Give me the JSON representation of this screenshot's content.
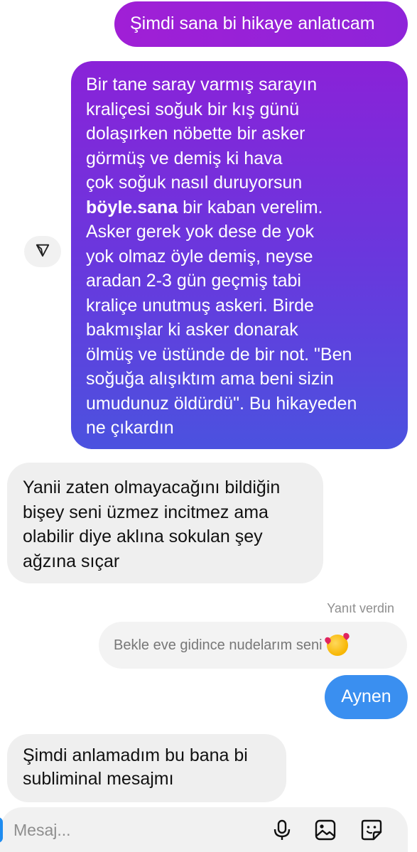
{
  "messages": {
    "m1": "Şimdi sana bi hikaye anlatıcam",
    "m2": {
      "l1": "Bir tane saray varmış sarayın",
      "l2": "kraliçesi soğuk bir kış günü",
      "l3": "dolaşırken nöbette bir asker",
      "l4": "görmüş ve demiş ki hava",
      "l5": "çok soğuk nasıl duruyorsun",
      "l6_bold": "böyle.sana",
      "l6_rest": " bir kaban verelim.",
      "l7": "Asker gerek yok dese de yok",
      "l8": "yok olmaz öyle demiş, neyse",
      "l9": "aradan 2-3 gün geçmiş tabi",
      "l10": "kraliçe unutmuş askeri. Birde",
      "l11": "bakmışlar ki asker donarak",
      "l12": "ölmüş ve üstünde de bir not. \"Ben",
      "l13": "soğuğa alışıktım ama beni sizin",
      "l14": "umudunuz öldürdü\". Bu hikayeden",
      "l15": "ne çıkardın"
    },
    "m4": {
      "l1": "Yanii zaten olmayacağını bildiğin",
      "l2": "bişey seni üzmez incitmez ama",
      "l3": "olabilir diye aklına sokulan şey",
      "l4": "ağzına sıçar"
    },
    "reply_meta": "Yanıt verdin",
    "reply_quote": "Bekle eve gidince nudelarım seni",
    "m5": "Aynen",
    "m6": {
      "l1": "Şimdi anlamadım bu bana bi",
      "l2": "subliminal mesajmı"
    }
  },
  "composer": {
    "placeholder": "Mesaj..."
  },
  "icons": {
    "forward": "send-forward-icon",
    "mic": "microphone-icon",
    "gallery": "image-gallery-icon",
    "sticker": "sticker-icon",
    "reply_emoji": "smiling-face-with-hearts-emoji"
  },
  "colors": {
    "outgoing_gradient_top": "#8a22d8",
    "outgoing_gradient_bottom": "#4b52df",
    "outgoing_blue": "#3a8ff0",
    "incoming_gray": "#efefef",
    "meta_gray": "#8e8e8e"
  }
}
